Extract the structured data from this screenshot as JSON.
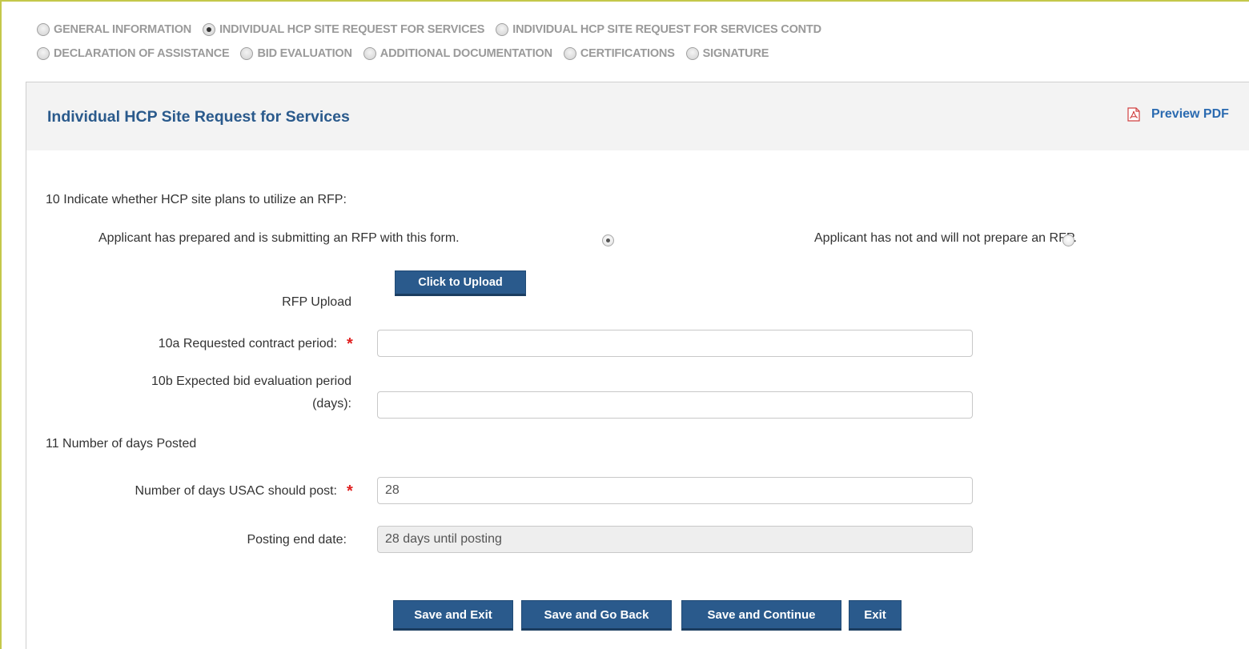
{
  "steps": {
    "row1": [
      {
        "label": "GENERAL INFORMATION",
        "active": false
      },
      {
        "label": "INDIVIDUAL HCP SITE REQUEST FOR SERVICES",
        "active": true
      },
      {
        "label": "INDIVIDUAL HCP SITE REQUEST FOR SERVICES CONTD",
        "active": false
      }
    ],
    "row2": [
      {
        "label": "DECLARATION OF ASSISTANCE",
        "active": false
      },
      {
        "label": "BID EVALUATION",
        "active": false
      },
      {
        "label": "ADDITIONAL DOCUMENTATION",
        "active": false
      },
      {
        "label": "CERTIFICATIONS",
        "active": false
      },
      {
        "label": "SIGNATURE",
        "active": false
      }
    ]
  },
  "panel": {
    "title": "Individual HCP Site Request for Services",
    "preview_label": "Preview PDF"
  },
  "form": {
    "q10_label": "10 Indicate whether HCP site plans to utilize an RFP:",
    "option_rfp_submitting": "Applicant has prepared and is submitting an RFP with this form.",
    "option_rfp_submitting_selected": true,
    "option_no_rfp": "Applicant has not and will not prepare an RFP.",
    "option_no_rfp_selected": false,
    "upload_button": "Click to Upload",
    "rfp_upload_label": "RFP Upload",
    "q10a_label": "10a Requested contract period:",
    "q10a_value": "",
    "q10b_label_line1": "10b Expected bid evaluation period",
    "q10b_label_line2": "(days):",
    "q10b_value": "",
    "q11_label": "11 Number of days Posted",
    "days_post_label": "Number of days USAC should post:",
    "days_post_value": "28",
    "posting_end_label": "Posting end date:",
    "posting_end_value": "28 days until posting",
    "required_mark": "*"
  },
  "buttons": {
    "save_exit": "Save and Exit",
    "save_back": "Save and Go Back",
    "save_continue": "Save and Continue",
    "exit": "Exit"
  },
  "colors": {
    "accent": "#2a5a8c",
    "link": "#2a6ab0",
    "required": "#e02020",
    "frame": "#c4c84a"
  }
}
